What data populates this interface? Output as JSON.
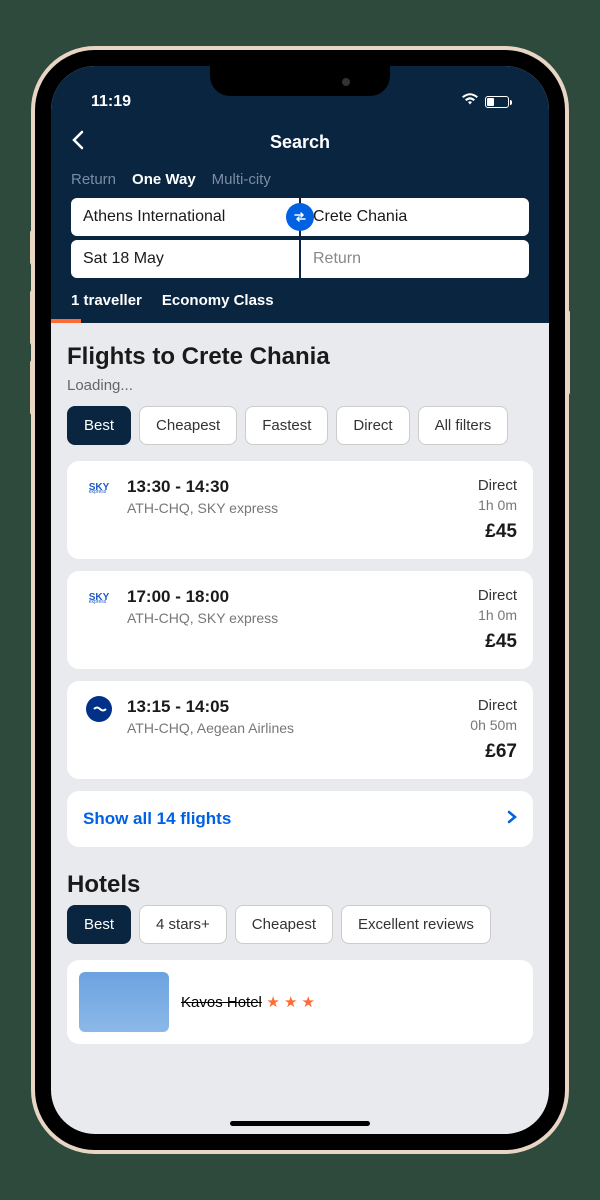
{
  "status": {
    "time": "11:19"
  },
  "nav": {
    "title": "Search"
  },
  "trip_tabs": {
    "return": "Return",
    "one_way": "One Way",
    "multi_city": "Multi-city"
  },
  "airports": {
    "from": "Athens International",
    "to": "Crete Chania"
  },
  "dates": {
    "depart": "Sat 18 May",
    "return": "Return"
  },
  "options": {
    "travellers": "1 traveller",
    "class": "Economy Class"
  },
  "flights": {
    "title": "Flights to Crete Chania",
    "loading": "Loading...",
    "filters": {
      "best": "Best",
      "cheapest": "Cheapest",
      "fastest": "Fastest",
      "direct": "Direct",
      "all": "All filters"
    },
    "results": [
      {
        "airline_code": "SKY",
        "airline_sub": "express",
        "times": "13:30 - 14:30",
        "route": "ATH-CHQ, SKY express",
        "stops": "Direct",
        "duration": "1h 0m",
        "price": "£45"
      },
      {
        "airline_code": "SKY",
        "airline_sub": "express",
        "times": "17:00 - 18:00",
        "route": "ATH-CHQ, SKY express",
        "stops": "Direct",
        "duration": "1h 0m",
        "price": "£45"
      },
      {
        "airline_code": "aegean",
        "times": "13:15 - 14:05",
        "route": "ATH-CHQ, Aegean Airlines",
        "stops": "Direct",
        "duration": "0h 50m",
        "price": "£67"
      }
    ],
    "show_all": "Show all 14 flights"
  },
  "hotels": {
    "title": "Hotels",
    "filters": {
      "best": "Best",
      "four_stars": "4 stars+",
      "cheapest": "Cheapest",
      "excellent": "Excellent reviews"
    },
    "first": {
      "name": "Kavos Hotel"
    }
  }
}
